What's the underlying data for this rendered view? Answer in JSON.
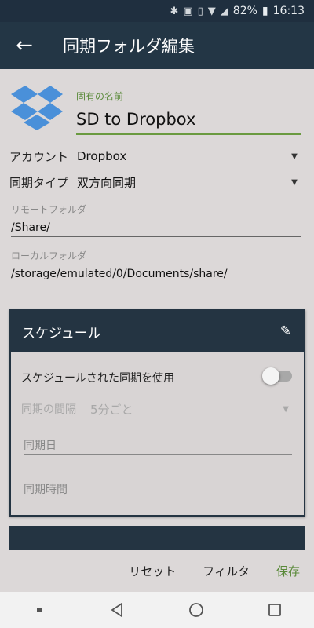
{
  "status_bar": {
    "icons": [
      "bluetooth-icon",
      "nfc-icon",
      "vibrate-icon",
      "wifi-icon",
      "signal-icon"
    ],
    "battery": "82%",
    "time": "16:13"
  },
  "app_bar": {
    "title": "同期フォルダ編集"
  },
  "form": {
    "name_label": "固有の名前",
    "name_value": "SD to Dropbox",
    "account_label": "アカウント",
    "account_value": "Dropbox",
    "sync_type_label": "同期タイプ",
    "sync_type_value": "双方向同期",
    "remote_label": "リモートフォルダ",
    "remote_value": "/Share/",
    "local_label": "ローカルフォルダ",
    "local_value": "/storage/emulated/0/Documents/share/"
  },
  "schedule": {
    "title": "スケジュール",
    "use_label": "スケジュールされた同期を使用",
    "use_enabled": false,
    "interval_label": "同期の間隔",
    "interval_value": "5分ごと",
    "day_placeholder": "同期日",
    "time_placeholder": "同期時間"
  },
  "actions": {
    "reset": "リセット",
    "filter": "フィルタ",
    "save": "保存"
  },
  "colors": {
    "app_bar": "#233645",
    "accent_green": "#5a8a3a",
    "background": "#dcd8d8"
  }
}
